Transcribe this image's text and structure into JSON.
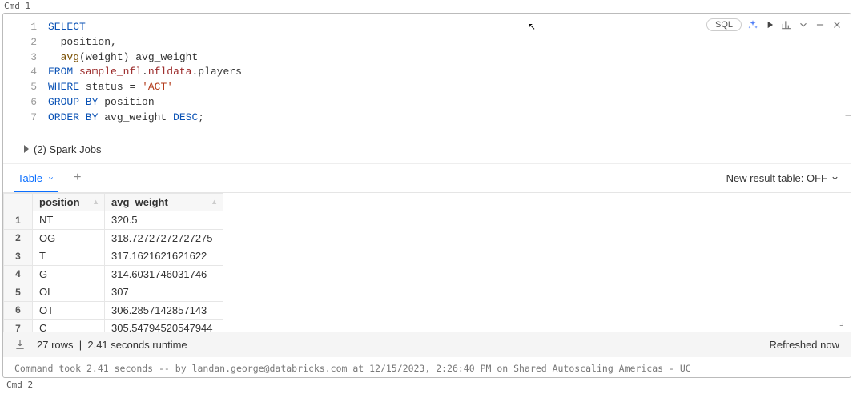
{
  "cell": {
    "title": "Cmd 1",
    "next": "Cmd 2"
  },
  "toolbar": {
    "lang": "SQL"
  },
  "code": {
    "tokens": [
      [
        [
          "kw",
          "SELECT"
        ]
      ],
      [
        [
          "",
          "  position"
        ],
        [
          "op",
          ","
        ]
      ],
      [
        [
          "",
          "  "
        ],
        [
          "fn",
          "avg"
        ],
        [
          "op",
          "("
        ],
        [
          "",
          "weight"
        ],
        [
          "op",
          ")"
        ],
        [
          "",
          " avg_weight"
        ]
      ],
      [
        [
          "kw",
          "FROM"
        ],
        [
          "",
          " "
        ],
        [
          "id",
          "sample_nfl"
        ],
        [
          "op",
          "."
        ],
        [
          "id",
          "nfldata"
        ],
        [
          "op",
          "."
        ],
        [
          "",
          "players"
        ]
      ],
      [
        [
          "kw",
          "WHERE"
        ],
        [
          "",
          " status "
        ],
        [
          "op",
          "="
        ],
        [
          "",
          " "
        ],
        [
          "str",
          "'ACT'"
        ]
      ],
      [
        [
          "kw",
          "GROUP BY"
        ],
        [
          "",
          " position"
        ]
      ],
      [
        [
          "kw",
          "ORDER BY"
        ],
        [
          "",
          " avg_weight "
        ],
        [
          "kw",
          "DESC"
        ],
        [
          "op",
          ";"
        ]
      ]
    ],
    "line_count": 7
  },
  "spark_jobs": {
    "label": "(2) Spark Jobs"
  },
  "tabs": {
    "active": "Table",
    "result_toggle": "New result table: OFF"
  },
  "table": {
    "columns": [
      "position",
      "avg_weight"
    ],
    "rows": [
      {
        "n": "1",
        "position": "NT",
        "avg_weight": "320.5"
      },
      {
        "n": "2",
        "position": "OG",
        "avg_weight": "318.72727272727275"
      },
      {
        "n": "3",
        "position": "T",
        "avg_weight": "317.1621621621622"
      },
      {
        "n": "4",
        "position": "G",
        "avg_weight": "314.6031746031746"
      },
      {
        "n": "5",
        "position": "OL",
        "avg_weight": "307"
      },
      {
        "n": "6",
        "position": "OT",
        "avg_weight": "306.2857142857143"
      },
      {
        "n": "7",
        "position": "C",
        "avg_weight": "305.54794520547944"
      }
    ]
  },
  "footer": {
    "rows": "27 rows",
    "runtime": "2.41 seconds runtime",
    "refreshed": "Refreshed now"
  },
  "meta": {
    "text": "Command took 2.41 seconds -- by landan.george@databricks.com at 12/15/2023, 2:26:40 PM on Shared Autoscaling Americas - UC"
  }
}
